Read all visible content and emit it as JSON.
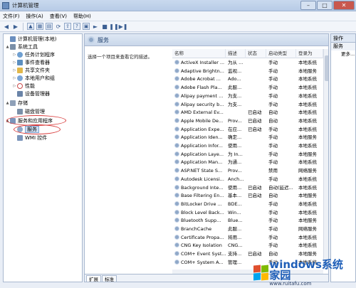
{
  "window": {
    "title": "计算机管理"
  },
  "menu": [
    "文件(F)",
    "操作(A)",
    "查看(V)",
    "帮助(H)"
  ],
  "toolbar": {
    "icons": [
      "back-icon",
      "forward-icon",
      "up-folder-icon",
      "show-tree-icon",
      "properties-icon",
      "refresh-icon",
      "export-icon",
      "help-icon",
      "console-icon",
      "play-icon",
      "stop-icon",
      "pause-icon",
      "restart-icon"
    ]
  },
  "tree": [
    {
      "label": "计算机管理(本地)",
      "level": 0,
      "expander": "",
      "icon": "computer-icon",
      "color": "#6b8fbf"
    },
    {
      "label": "系统工具",
      "level": 1,
      "expander": "▲",
      "icon": "tools-icon",
      "color": "#7a8fa8"
    },
    {
      "label": "任务计划程序",
      "level": 2,
      "expander": "▷",
      "icon": "clock-icon",
      "color": "#6f9fd0"
    },
    {
      "label": "事件查看器",
      "level": 2,
      "expander": "▷",
      "icon": "event-viewer-icon",
      "color": "#5c8fc0"
    },
    {
      "label": "共享文件夹",
      "level": 2,
      "expander": "▷",
      "icon": "shared-folder-icon",
      "color": "#e2b84a"
    },
    {
      "label": "本地用户和组",
      "level": 2,
      "expander": "▷",
      "icon": "users-icon",
      "color": "#7aa5d6"
    },
    {
      "label": "性能",
      "level": 2,
      "expander": "▷",
      "icon": "performance-icon",
      "color": "#c94a4a"
    },
    {
      "label": "设备管理器",
      "level": 2,
      "expander": "",
      "icon": "device-manager-icon",
      "color": "#6a84a8"
    },
    {
      "label": "存储",
      "level": 1,
      "expander": "▲",
      "icon": "storage-icon",
      "color": "#8ea0b8"
    },
    {
      "label": "磁盘管理",
      "level": 2,
      "expander": "",
      "icon": "disk-icon",
      "color": "#7a8fa8"
    },
    {
      "label": "服务和应用程序",
      "level": 1,
      "expander": "▲",
      "icon": "services-apps-icon",
      "color": "#7b95bb"
    },
    {
      "label": "服务",
      "level": 2,
      "expander": "",
      "icon": "gear-icon",
      "color": "#8fa8c8",
      "selected": true
    },
    {
      "label": "WMI 控件",
      "level": 2,
      "expander": "",
      "icon": "wmi-icon",
      "color": "#7b95bb"
    }
  ],
  "center": {
    "header": "服务",
    "description": "选择一个项目来查看它的描述。",
    "columns": [
      "名称",
      "描述",
      "状态",
      "启动类型",
      "登录为"
    ],
    "rows": [
      [
        "ActiveX Installer ...",
        "为从 ...",
        "",
        "手动",
        "本地系统"
      ],
      [
        "Adaptive Brightn...",
        "监视...",
        "",
        "手动",
        "本地服务"
      ],
      [
        "Adobe Acrobat ...",
        "Ado...",
        "",
        "手动",
        "本地系统"
      ],
      [
        "Adobe Flash Pla...",
        "此服...",
        "",
        "手动",
        "本地系统"
      ],
      [
        "Alipay payment ...",
        "为支...",
        "",
        "手动",
        "本地系统"
      ],
      [
        "Alipay security b...",
        "为支...",
        "",
        "手动",
        "本地系统"
      ],
      [
        "AMD External Ev...",
        "",
        "已启动",
        "自动",
        "本地系统"
      ],
      [
        "Apple Mobile De...",
        "Prov...",
        "已启动",
        "自动",
        "本地系统"
      ],
      [
        "Application Expe...",
        "在应...",
        "已启动",
        "手动",
        "本地系统"
      ],
      [
        "Application Iden...",
        "确定...",
        "",
        "手动",
        "本地服务"
      ],
      [
        "Application Infor...",
        "使用...",
        "",
        "手动",
        "本地系统"
      ],
      [
        "Application Laye...",
        "为 In...",
        "",
        "手动",
        "本地服务"
      ],
      [
        "Application Man...",
        "为通...",
        "",
        "手动",
        "本地系统"
      ],
      [
        "ASP.NET State S...",
        "Prov...",
        "",
        "禁用",
        "网络服务"
      ],
      [
        "Autodesk Licensi...",
        "Anch...",
        "",
        "手动",
        "本地系统"
      ],
      [
        "Background Inte...",
        "使用...",
        "已启动",
        "自动(延迟...",
        "本地系统"
      ],
      [
        "Base Filtering En...",
        "基本...",
        "已启动",
        "自动",
        "本地服务"
      ],
      [
        "BitLocker Drive ...",
        "BDE...",
        "",
        "手动",
        "本地系统"
      ],
      [
        "Block Level Back...",
        "Win...",
        "",
        "手动",
        "本地系统"
      ],
      [
        "Bluetooth Supp...",
        "Blue...",
        "",
        "手动",
        "本地服务"
      ],
      [
        "BranchCache",
        "此服...",
        "",
        "手动",
        "网络服务"
      ],
      [
        "Certificate Propa...",
        "将用...",
        "",
        "手动",
        "本地系统"
      ],
      [
        "CNG Key Isolation",
        "CNG...",
        "",
        "手动",
        "本地系统"
      ],
      [
        "COM+ Event Syst...",
        "支持...",
        "已启动",
        "自动",
        "本地服务"
      ],
      [
        "COM+ System A...",
        "管理...",
        "",
        "手动",
        "本地系统"
      ]
    ],
    "tabs": [
      "扩展",
      "标准"
    ]
  },
  "actions": {
    "header": "操作",
    "section": "服务",
    "more": "更多..."
  },
  "watermark": {
    "brand": "windows系统家园",
    "url": "www.ruitafu.com"
  }
}
